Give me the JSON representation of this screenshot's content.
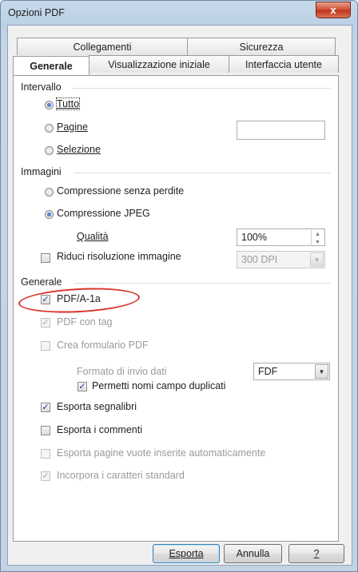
{
  "window": {
    "title": "Opzioni PDF",
    "close_glyph": "x"
  },
  "tabs": {
    "row1": [
      "Collegamenti",
      "Sicurezza"
    ],
    "row2": [
      "Generale",
      "Visualizzazione iniziale",
      "Interfaccia utente"
    ],
    "active": "Generale"
  },
  "intervallo": {
    "header": "Intervallo",
    "options": [
      {
        "label": "Tutto",
        "selected": true
      },
      {
        "label": "Pagine",
        "selected": false
      },
      {
        "label": "Selezione",
        "selected": false
      }
    ],
    "pages_value": ""
  },
  "immagini": {
    "header": "Immagini",
    "lossless_label": "Compressione senza perdite",
    "jpeg_label": "Compressione JPEG",
    "jpeg_selected": true,
    "quality_label": "Qualità",
    "quality_value": "100%",
    "reduce_label": "Riduci risoluzione immagine",
    "reduce_checked": false,
    "dpi_value": "300 DPI"
  },
  "generale": {
    "header": "Generale",
    "pdfa_label": "PDF/A-1a",
    "pdfa_checked": true,
    "tagged_label": "PDF con tag",
    "tagged_checked": true,
    "form_label": "Crea formulario PDF",
    "form_checked": false,
    "submit_format_label": "Formato di invio dati",
    "submit_format_value": "FDF",
    "dup_names_label": "Permetti nomi campo duplicati",
    "dup_names_checked": true,
    "bookmarks_label": "Esporta segnalibri",
    "bookmarks_checked": true,
    "comments_label": "Esporta i commenti",
    "comments_checked": false,
    "blank_pages_label": "Esporta pagine vuote inserite automaticamente",
    "blank_pages_checked": false,
    "embed_fonts_label": "Incorpora i caratteri standard",
    "embed_fonts_checked": true
  },
  "buttons": {
    "export": "Esporta",
    "cancel": "Annulla",
    "help": "?"
  },
  "colors": {
    "annotation_oval": "#d8342a",
    "close_button": "#c0361c"
  }
}
